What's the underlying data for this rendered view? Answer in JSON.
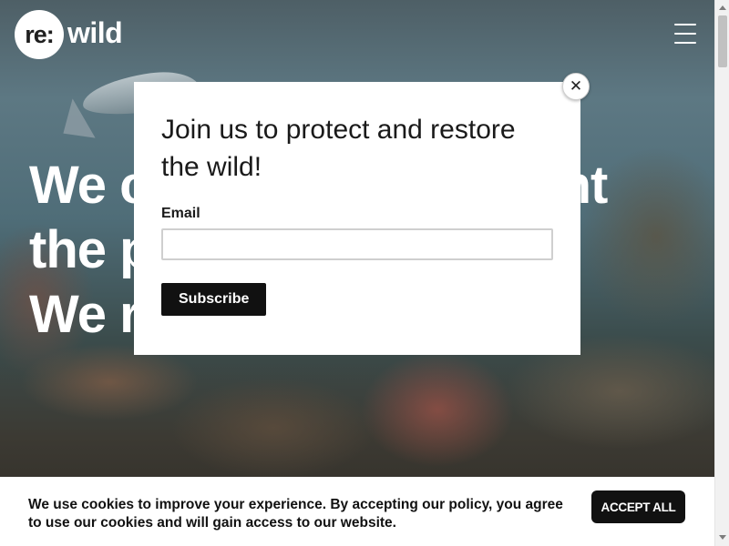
{
  "header": {
    "logo_mark": "re:",
    "logo_word": "wild",
    "menu_icon": "hamburger-menu-icon"
  },
  "hero": {
    "heading_partial": "We c                                         ent the p We r"
  },
  "modal": {
    "title": "Join us to protect and restore the wild!",
    "email_label": "Email",
    "email_value": "",
    "email_placeholder": "",
    "subscribe_label": "Subscribe",
    "close_icon": "close-icon",
    "close_glyph": "✕"
  },
  "cookie_banner": {
    "message": "We use cookies to improve your experience. By accepting our policy, you agree to use our cookies and will gain access to our website.",
    "accept_label": "ACCEPT ALL"
  },
  "colors": {
    "button_bg": "#111111",
    "modal_bg": "#ffffff",
    "hero_text": "#ffffff"
  }
}
